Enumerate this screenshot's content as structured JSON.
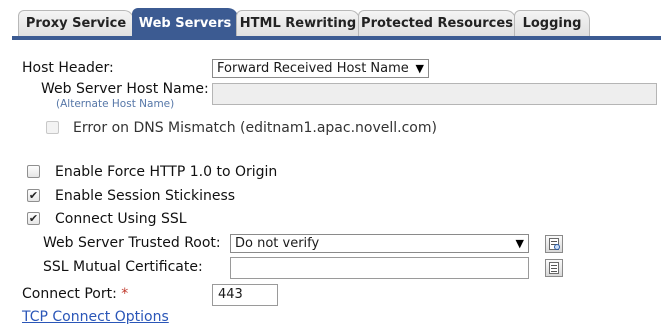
{
  "tabs": [
    {
      "label": "Proxy Service",
      "active": false
    },
    {
      "label": "Web Servers",
      "active": true
    },
    {
      "label": "HTML Rewriting",
      "active": false
    },
    {
      "label": "Protected Resources",
      "active": false
    },
    {
      "label": "Logging",
      "active": false
    }
  ],
  "form": {
    "host_header": {
      "label": "Host Header:",
      "value": "Forward Received Host Name"
    },
    "web_server_host_name": {
      "label": "Web Server Host Name:",
      "sublabel": "(Alternate Host Name)",
      "value": ""
    },
    "dns_mismatch": {
      "label": "Error on DNS Mismatch (editnam1.apac.novell.com)",
      "checked": false
    },
    "force_http10": {
      "label": "Enable Force HTTP 1.0 to Origin",
      "checked": false
    },
    "session_stickiness": {
      "label": "Enable Session Stickiness",
      "checked": true
    },
    "connect_ssl": {
      "label": "Connect Using SSL",
      "checked": true
    },
    "trusted_root": {
      "label": "Web Server Trusted Root:",
      "value": "Do not verify"
    },
    "mutual_cert": {
      "label": "SSL Mutual Certificate:",
      "value": ""
    },
    "connect_port": {
      "label": "Connect Port:",
      "required_mark": "*",
      "value": "443"
    },
    "tcp_link": "TCP Connect Options"
  },
  "colors": {
    "accent": "#3c5b92",
    "link": "#2a56b8",
    "required": "#c0392b"
  },
  "icons": {
    "trusted_root_browse": "certificate-search-icon",
    "mutual_cert_browse": "certificate-list-icon"
  }
}
